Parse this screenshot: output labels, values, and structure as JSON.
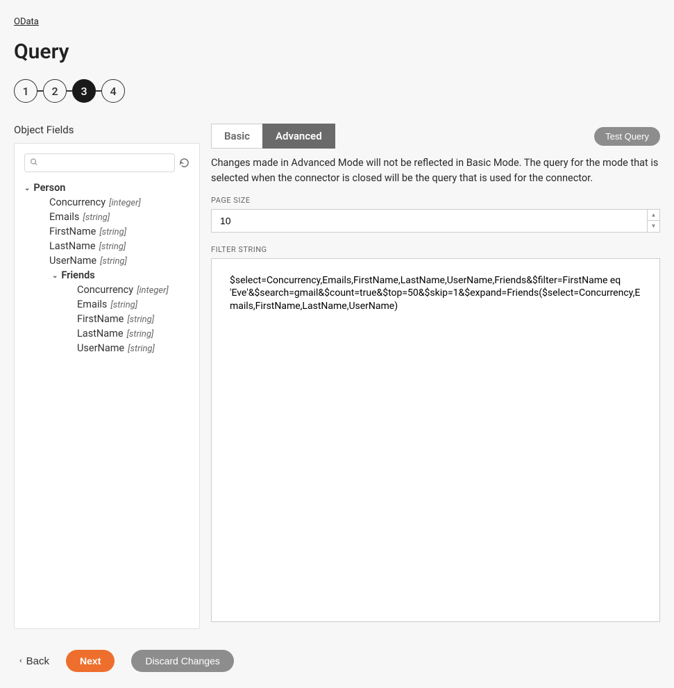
{
  "breadcrumb": "OData",
  "title": "Query",
  "stepper": {
    "steps": [
      "1",
      "2",
      "3",
      "4"
    ],
    "active_index": 2
  },
  "left": {
    "title": "Object Fields",
    "search_placeholder": "",
    "tree": {
      "root": {
        "label": "Person"
      },
      "fields": [
        {
          "name": "Concurrency",
          "type": "[integer]"
        },
        {
          "name": "Emails",
          "type": "[string]"
        },
        {
          "name": "FirstName",
          "type": "[string]"
        },
        {
          "name": "LastName",
          "type": "[string]"
        },
        {
          "name": "UserName",
          "type": "[string]"
        }
      ],
      "child": {
        "label": "Friends",
        "fields": [
          {
            "name": "Concurrency",
            "type": "[integer]"
          },
          {
            "name": "Emails",
            "type": "[string]"
          },
          {
            "name": "FirstName",
            "type": "[string]"
          },
          {
            "name": "LastName",
            "type": "[string]"
          },
          {
            "name": "UserName",
            "type": "[string]"
          }
        ]
      }
    }
  },
  "right": {
    "tabs": {
      "basic": "Basic",
      "advanced": "Advanced",
      "active": "advanced"
    },
    "test_label": "Test Query",
    "mode_note": "Changes made in Advanced Mode will not be reflected in Basic Mode. The query for the mode that is selected when the connector is closed will be the query that is used for the connector.",
    "page_size_label": "PAGE SIZE",
    "page_size_value": "10",
    "filter_label": "FILTER STRING",
    "filter_value": "$select=Concurrency,Emails,FirstName,LastName,UserName,Friends&$filter=FirstName eq 'Eve'&$search=gmail&$count=true&$top=50&$skip=1&$expand=Friends($select=Concurrency,Emails,FirstName,LastName,UserName)"
  },
  "footer": {
    "back": "Back",
    "next": "Next",
    "discard": "Discard Changes"
  }
}
